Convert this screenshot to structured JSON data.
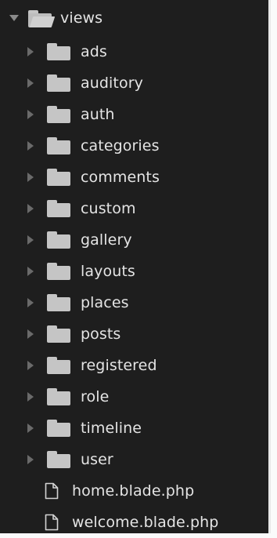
{
  "tree": {
    "root": {
      "label": "views",
      "expanded": true
    },
    "folders": [
      {
        "label": "ads"
      },
      {
        "label": "auditory"
      },
      {
        "label": "auth"
      },
      {
        "label": "categories"
      },
      {
        "label": "comments"
      },
      {
        "label": "custom"
      },
      {
        "label": "gallery"
      },
      {
        "label": "layouts"
      },
      {
        "label": "places"
      },
      {
        "label": "posts"
      },
      {
        "label": "registered"
      },
      {
        "label": "role"
      },
      {
        "label": "timeline"
      },
      {
        "label": "user"
      }
    ],
    "files": [
      {
        "label": "home.blade.php"
      },
      {
        "label": "welcome.blade.php"
      }
    ]
  },
  "theme": {
    "background": "#1e1e1e",
    "text": "#e4e4e4",
    "folder_icon": "#c5c5c5",
    "arrow": "#6a6a6a"
  }
}
